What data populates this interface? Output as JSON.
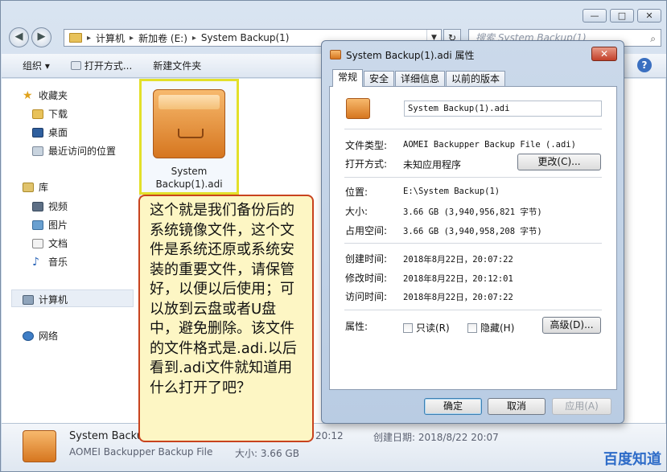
{
  "explorer": {
    "caption_buttons": {
      "minimize": "—",
      "maximize": "□",
      "close": "✕"
    },
    "nav": {
      "back": "◀",
      "forward": "▶"
    },
    "address": {
      "crumbs": [
        "计算机",
        "新加卷 (E:)",
        "System Backup(1)"
      ]
    },
    "search_placeholder": "搜索 System Backup(1)",
    "toolbar": {
      "organize": "组织 ▾",
      "open_with": "打开方式...",
      "new_folder": "新建文件夹"
    },
    "help": "?",
    "sidebar": {
      "favorites": "收藏夹",
      "downloads": "下载",
      "desktop": "桌面",
      "recent": "最近访问的位置",
      "libraries": "库",
      "videos": "视频",
      "pictures": "图片",
      "documents": "文档",
      "music": "音乐",
      "computer": "计算机",
      "network": "网络"
    },
    "file": {
      "name": "System Backup(1).adi"
    },
    "details": {
      "title": "System Backup",
      "type": "AOMEI Backupper Backup File",
      "modified": "20:12",
      "size": "大小: 3.66 GB",
      "created": "创建日期: 2018/8/22 20:07"
    }
  },
  "note": "这个就是我们备份后的系统镜像文件，这个文件是系统还原或系统安装的重要文件，请保管好，以便以后使用；可以放到云盘或者U盘中，避免删除。该文件的文件格式是.adi.以后看到.adi文件就知道用什么打开了吧？",
  "watermark": "百度知道",
  "dialog": {
    "title": "System Backup(1).adi 属性",
    "close": "✕",
    "tabs": [
      "常规",
      "安全",
      "详细信息",
      "以前的版本"
    ],
    "filename": "System Backup(1).adi",
    "type_label": "文件类型:",
    "type_value": "AOMEI Backupper Backup File (.adi)",
    "opens_label": "打开方式:",
    "opens_value": "未知应用程序",
    "change_button": "更改(C)...",
    "location_label": "位置:",
    "location_value": "E:\\System Backup(1)",
    "size_label": "大小:",
    "size_value": "3.66 GB (3,940,956,821 字节)",
    "disk_label": "占用空间:",
    "disk_value": "3.66 GB (3,940,958,208 字节)",
    "created_label": "创建时间:",
    "created_value": "2018年8月22日，20:07:22",
    "modified_label": "修改时间:",
    "modified_value": "2018年8月22日，20:12:01",
    "accessed_label": "访问时间:",
    "accessed_value": "2018年8月22日，20:07:22",
    "attributes_label": "属性:",
    "readonly": "只读(R)",
    "hidden": "隐藏(H)",
    "advanced_button": "高级(D)...",
    "ok": "确定",
    "cancel": "取消",
    "apply": "应用(A)"
  }
}
